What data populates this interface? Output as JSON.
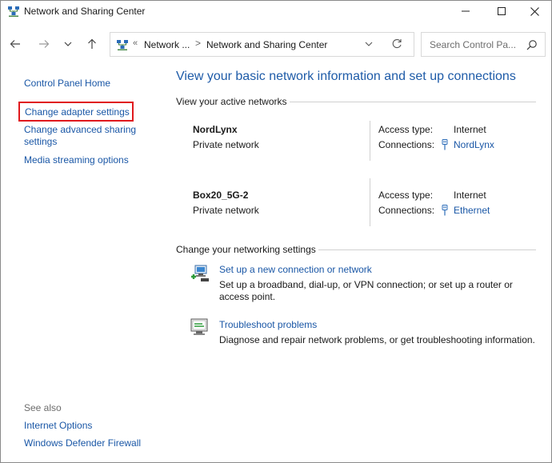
{
  "window": {
    "title": "Network and Sharing Center"
  },
  "address": {
    "sep": "«",
    "crumb1": "Network ...",
    "arrow": ">",
    "crumb2": "Network and Sharing Center",
    "search_placeholder": "Search Control Pa..."
  },
  "sidebar": {
    "home": "Control Panel Home",
    "adapter": "Change adapter settings",
    "advanced": "Change advanced sharing settings",
    "media": "Media streaming options",
    "see_also": "See also",
    "internet_options": "Internet Options",
    "firewall": "Windows Defender Firewall"
  },
  "main": {
    "heading": "View your basic network information and set up connections",
    "active_networks": "View your active networks",
    "networks": [
      {
        "name": "NordLynx",
        "type": "Private network",
        "access_label": "Access type:",
        "access_value": "Internet",
        "connections_label": "Connections:",
        "connection": "NordLynx"
      },
      {
        "name": "Box20_5G-2",
        "type": "Private network",
        "access_label": "Access type:",
        "access_value": "Internet",
        "connections_label": "Connections:",
        "connection": "Ethernet"
      }
    ],
    "change_settings": "Change your networking settings",
    "tasks": [
      {
        "link": "Set up a new connection or network",
        "desc": "Set up a broadband, dial-up, or VPN connection; or set up a router or access point."
      },
      {
        "link": "Troubleshoot problems",
        "desc": "Diagnose and repair network problems, or get troubleshooting information."
      }
    ]
  },
  "colors": {
    "link": "#1a57a6",
    "heading": "#1e5ba8",
    "highlight": "#e0191d"
  },
  "icons": {
    "title": "network-center-icon",
    "back": "arrow-left-icon",
    "forward": "arrow-right-icon",
    "recent": "chevron-down-icon",
    "up": "arrow-up-icon",
    "refresh": "refresh-icon",
    "search": "search-icon",
    "connection": "ethernet-plug-icon",
    "setup": "new-connection-icon",
    "troubleshoot": "troubleshoot-icon"
  }
}
